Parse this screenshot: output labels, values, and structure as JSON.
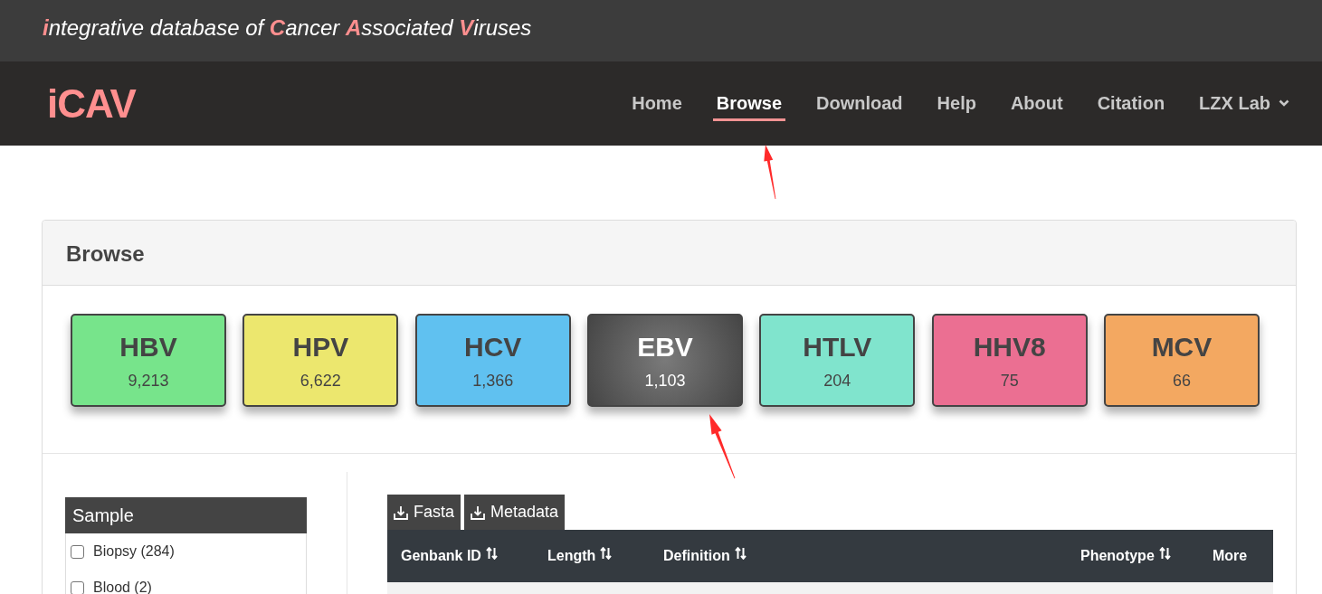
{
  "tagline": [
    {
      "text": "i",
      "accent": true
    },
    {
      "text": "ntegrative database of ",
      "accent": false
    },
    {
      "text": "C",
      "accent": true
    },
    {
      "text": "ancer ",
      "accent": false
    },
    {
      "text": "A",
      "accent": true
    },
    {
      "text": "ssociated ",
      "accent": false
    },
    {
      "text": "V",
      "accent": true
    },
    {
      "text": "iruses",
      "accent": false
    }
  ],
  "logo": "iCAV",
  "nav": [
    {
      "label": "Home",
      "kind": "link",
      "selected": false,
      "arrow": false
    },
    {
      "label": "Browse",
      "kind": "link",
      "selected": true,
      "arrow": true
    },
    {
      "label": "Download",
      "kind": "link",
      "selected": false,
      "arrow": false
    },
    {
      "label": "Help",
      "kind": "link",
      "selected": false,
      "arrow": false
    },
    {
      "label": "About",
      "kind": "link",
      "selected": false,
      "arrow": false
    },
    {
      "label": "Citation",
      "kind": "link",
      "selected": false,
      "arrow": false
    },
    {
      "label": "LZX Lab",
      "kind": "menu",
      "selected": false,
      "arrow": false
    }
  ],
  "panel": {
    "title": "Browse"
  },
  "virus_cards": [
    {
      "name": "HBV",
      "count": "9,213",
      "color": "#77e48b",
      "selected": false,
      "arrow": false
    },
    {
      "name": "HPV",
      "count": "6,622",
      "color": "#ece76e",
      "selected": false,
      "arrow": false
    },
    {
      "name": "HCV",
      "count": "1,366",
      "color": "#60c1f0",
      "selected": false,
      "arrow": false
    },
    {
      "name": "EBV",
      "count": "1,103",
      "color": "#454545",
      "selected": true,
      "arrow": true
    },
    {
      "name": "HTLV",
      "count": "204",
      "color": "#80e4cd",
      "selected": false,
      "arrow": false
    },
    {
      "name": "HHV8",
      "count": "75",
      "color": "#eb6f92",
      "selected": false,
      "arrow": false
    },
    {
      "name": "MCV",
      "count": "66",
      "color": "#f3a861",
      "selected": false,
      "arrow": false
    }
  ],
  "filter": {
    "title": "Sample",
    "options": [
      {
        "label": "Biopsy (284)",
        "checked": false
      },
      {
        "label": "Blood (2)",
        "checked": false
      }
    ]
  },
  "downloads": [
    {
      "label": "Fasta"
    },
    {
      "label": "Metadata"
    }
  ],
  "table": {
    "columns": [
      {
        "label": "Genbank ID",
        "sortable": true
      },
      {
        "label": "Length",
        "sortable": true
      },
      {
        "label": "Definition",
        "sortable": true
      },
      {
        "label": "Phenotype",
        "sortable": true
      },
      {
        "label": "More",
        "sortable": false
      }
    ]
  }
}
